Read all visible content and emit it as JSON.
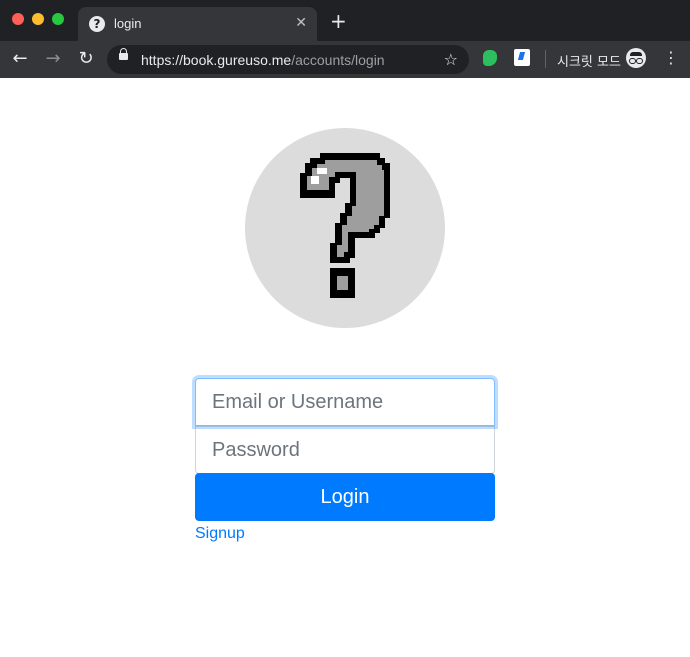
{
  "browser": {
    "tab": {
      "title": "login",
      "close_glyph": "✕"
    },
    "new_tab_glyph": "+",
    "nav": {
      "back_glyph": "←",
      "forward_glyph": "→",
      "reload_glyph": "↻"
    },
    "address_bar": {
      "url_host": "https://book.gureuso.me",
      "url_path": "/accounts/login",
      "bookmark_glyph": "☆"
    },
    "incognito_label": "시크릿 모드",
    "menu_glyph": "⋮"
  },
  "page": {
    "avatar_icon": "question-mark-pixel-icon",
    "login_form": {
      "email_placeholder": "Email or Username",
      "password_placeholder": "Password",
      "login_button": "Login",
      "signup_link": "Signup"
    }
  },
  "colors": {
    "primary": "#007bff",
    "avatar_bg": "#dcdcdc",
    "chrome_dark": "#202124"
  }
}
